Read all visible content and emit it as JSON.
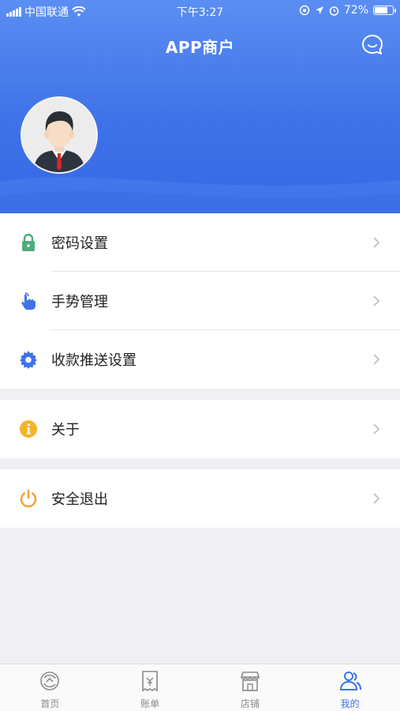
{
  "status_bar": {
    "carrier": "中国联通",
    "time": "下午3:27",
    "battery_text": "72%",
    "battery_level": 0.72
  },
  "header": {
    "title": "APP商户",
    "chat_icon": "chat-bubble-icon"
  },
  "menu": {
    "group1": [
      {
        "label": "密码设置",
        "icon": "lock-icon",
        "color": "#4cae7b"
      },
      {
        "label": "手势管理",
        "icon": "hand-tap-icon",
        "color": "#3f73e8"
      },
      {
        "label": "收款推送设置",
        "icon": "gear-icon",
        "color": "#3f73e8"
      }
    ],
    "group2": [
      {
        "label": "关于",
        "icon": "info-icon",
        "color": "#f4b42a"
      }
    ],
    "group3": [
      {
        "label": "安全退出",
        "icon": "power-icon",
        "color": "#f0a032"
      }
    ]
  },
  "tabbar": {
    "tabs": [
      {
        "label": "首页",
        "icon": "home-swirl-icon"
      },
      {
        "label": "账单",
        "icon": "receipt-icon"
      },
      {
        "label": "店铺",
        "icon": "store-icon"
      },
      {
        "label": "我的",
        "icon": "users-icon",
        "active": true
      }
    ]
  },
  "colors": {
    "accent": "#3f73e8",
    "background": "#efeff4"
  }
}
